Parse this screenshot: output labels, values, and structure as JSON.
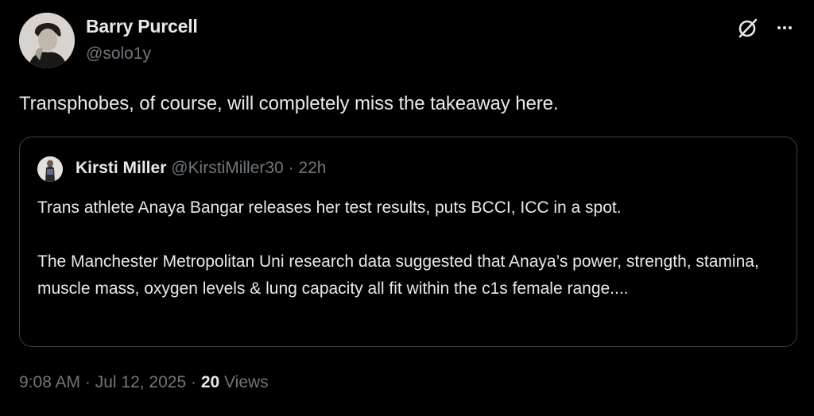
{
  "author": {
    "display_name": "Barry Purcell",
    "handle": "@solo1y",
    "avatar_icon": "profile-photo"
  },
  "tweet": {
    "text": "Transphobes, of course, will completely miss the takeaway here.",
    "actions": [
      "grok-icon",
      "more-icon"
    ]
  },
  "quoted_tweet": {
    "display_name": "Kirsti Miller",
    "handle": "@KirstiMiller30",
    "separator": "·",
    "time": "22h",
    "paragraph_1": "Trans athlete Anaya Bangar releases her test results, puts BCCI, ICC in a spot.",
    "paragraph_2": "The Manchester Metropolitan Uni research data suggested that Anaya’s power, strength, stamina, muscle mass, oxygen levels & lung capacity all fit within the c1s female range...."
  },
  "meta": {
    "timestamp": "9:08 AM · Jul 12, 2025",
    "separator": "·",
    "views_count": "20",
    "views_label": "Views"
  },
  "colors": {
    "background": "#000000",
    "primary_text": "#e7e9ea",
    "secondary_text": "#71767b",
    "border": "#3a3e42"
  }
}
